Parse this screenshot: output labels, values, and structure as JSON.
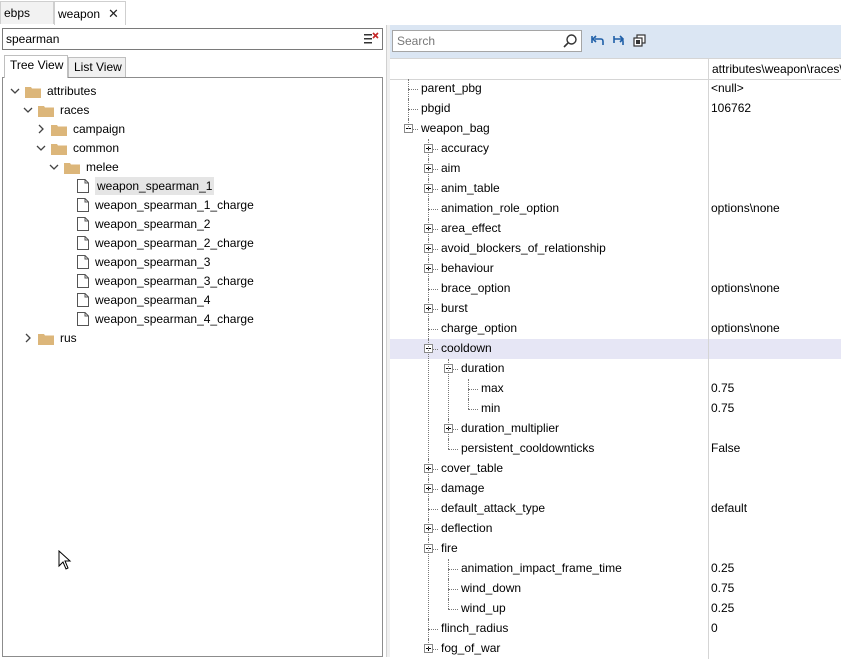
{
  "tabs": [
    {
      "label": "ebps",
      "active": false
    },
    {
      "label": "weapon",
      "active": true,
      "close": "✕"
    }
  ],
  "left": {
    "filter_value": "spearman",
    "view_tabs": [
      "Tree View",
      "List View"
    ],
    "tree": [
      {
        "label": "attributes",
        "type": "folder",
        "expanded": true
      },
      {
        "label": "races",
        "type": "folder",
        "expanded": true
      },
      {
        "label": "campaign",
        "type": "folder",
        "expanded": false
      },
      {
        "label": "common",
        "type": "folder",
        "expanded": true
      },
      {
        "label": "melee",
        "type": "folder",
        "expanded": true
      },
      {
        "label": "weapon_spearman_1",
        "type": "file",
        "selected": true
      },
      {
        "label": "weapon_spearman_1_charge",
        "type": "file"
      },
      {
        "label": "weapon_spearman_2",
        "type": "file"
      },
      {
        "label": "weapon_spearman_2_charge",
        "type": "file"
      },
      {
        "label": "weapon_spearman_3",
        "type": "file"
      },
      {
        "label": "weapon_spearman_3_charge",
        "type": "file"
      },
      {
        "label": "weapon_spearman_4",
        "type": "file"
      },
      {
        "label": "weapon_spearman_4_charge",
        "type": "file"
      },
      {
        "label": "rus",
        "type": "folder",
        "expanded": false
      }
    ]
  },
  "right": {
    "search_placeholder": "Search",
    "column_header": "attributes\\weapon\\races\\",
    "rows": [
      {
        "name": "parent_pbg",
        "value": "<null>",
        "expander": "none"
      },
      {
        "name": "pbgid",
        "value": "106762",
        "expander": "none"
      },
      {
        "name": "weapon_bag",
        "value": "",
        "expander": "minus"
      },
      {
        "name": "accuracy",
        "value": "",
        "expander": "plus"
      },
      {
        "name": "aim",
        "value": "",
        "expander": "plus"
      },
      {
        "name": "anim_table",
        "value": "",
        "expander": "plus"
      },
      {
        "name": "animation_role_option",
        "value": "options\\none",
        "expander": "none"
      },
      {
        "name": "area_effect",
        "value": "",
        "expander": "plus"
      },
      {
        "name": "avoid_blockers_of_relationship",
        "value": "",
        "expander": "plus"
      },
      {
        "name": "behaviour",
        "value": "",
        "expander": "plus"
      },
      {
        "name": "brace_option",
        "value": "options\\none",
        "expander": "none"
      },
      {
        "name": "burst",
        "value": "",
        "expander": "plus"
      },
      {
        "name": "charge_option",
        "value": "options\\none",
        "expander": "none"
      },
      {
        "name": "cooldown",
        "value": "",
        "expander": "minus",
        "highlight": true
      },
      {
        "name": "duration",
        "value": "",
        "expander": "minus"
      },
      {
        "name": "max",
        "value": "0.75",
        "expander": "none"
      },
      {
        "name": "min",
        "value": "0.75",
        "expander": "none"
      },
      {
        "name": "duration_multiplier",
        "value": "",
        "expander": "plus"
      },
      {
        "name": "persistent_cooldownticks",
        "value": "False",
        "expander": "none"
      },
      {
        "name": "cover_table",
        "value": "",
        "expander": "plus"
      },
      {
        "name": "damage",
        "value": "",
        "expander": "plus"
      },
      {
        "name": "default_attack_type",
        "value": "default",
        "expander": "none"
      },
      {
        "name": "deflection",
        "value": "",
        "expander": "plus"
      },
      {
        "name": "fire",
        "value": "",
        "expander": "minus"
      },
      {
        "name": "animation_impact_frame_time",
        "value": "0.25",
        "expander": "none"
      },
      {
        "name": "wind_down",
        "value": "0.75",
        "expander": "none"
      },
      {
        "name": "wind_up",
        "value": "0.25",
        "expander": "none"
      },
      {
        "name": "flinch_radius",
        "value": "0",
        "expander": "none"
      },
      {
        "name": "fog_of_war",
        "value": "",
        "expander": "plus"
      }
    ]
  },
  "colors": {
    "toolbar_bg": "#dbe6f3",
    "highlight_row": "#e6e6f5",
    "folder": "#dcb67a"
  }
}
